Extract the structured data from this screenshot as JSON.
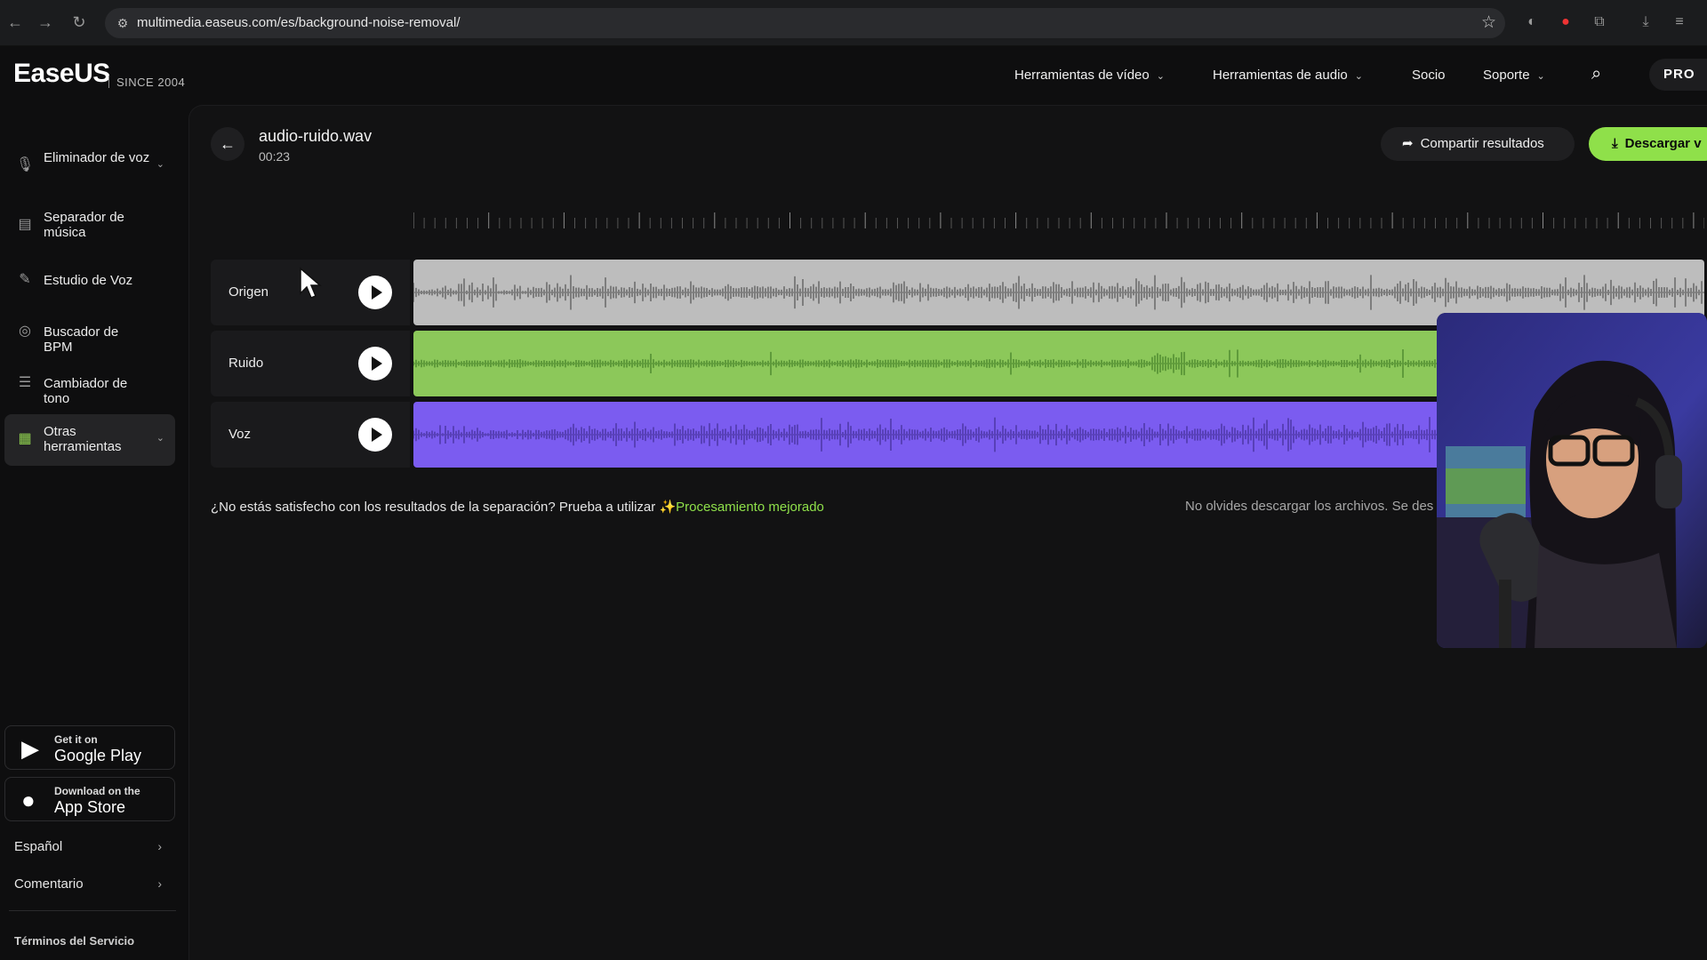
{
  "browser": {
    "url": "multimedia.easeus.com/es/background-noise-removal/"
  },
  "header": {
    "logo": "EaseUS",
    "since": "SINCE 2004",
    "menu": [
      {
        "label": "Herramientas de vídeo",
        "dropdown": true
      },
      {
        "label": "Herramientas de audio",
        "dropdown": true
      },
      {
        "label": "Socio",
        "dropdown": false
      },
      {
        "label": "Soporte",
        "dropdown": true
      }
    ],
    "pro_label": "PRO"
  },
  "sidebar": {
    "items": [
      {
        "label": "Eliminador de voz",
        "icon": "microphone-icon",
        "expandable": true
      },
      {
        "label": "Separador de música",
        "icon": "music-box-icon",
        "expandable": false
      },
      {
        "label": "Estudio de Voz",
        "icon": "magic-wand-icon",
        "expandable": false
      },
      {
        "label": "Buscador de BPM",
        "icon": "bpm-icon",
        "expandable": false
      },
      {
        "label": "Cambiador de tono",
        "icon": "sliders-icon",
        "expandable": false
      },
      {
        "label": "Otras herramientas",
        "icon": "grid-icon",
        "expandable": true,
        "active": true
      }
    ],
    "google_play": {
      "small": "Get it on",
      "big": "Google Play"
    },
    "app_store": {
      "small": "Download on the",
      "big": "App Store"
    },
    "language": "Español",
    "feedback": "Comentario",
    "terms": "Términos del Servicio"
  },
  "file": {
    "name": "audio-ruido.wav",
    "duration": "00:23",
    "back_icon": "arrow-left-icon"
  },
  "actions": {
    "share": "Compartir resultados",
    "download": "Descargar v"
  },
  "tracks": [
    {
      "name": "Origen",
      "color": "#bdbdbd",
      "wave_color": "#7d7d7d"
    },
    {
      "name": "Ruido",
      "color": "#8cc85a",
      "wave_color": "#5f9b3b"
    },
    {
      "name": "Voz",
      "color": "#7b5cf0",
      "wave_color": "#5840b8"
    }
  ],
  "hint": {
    "text": "¿No estás satisfecho con los resultados de la separación? Prueba a utilizar",
    "sparkle": "✨",
    "link": "Procesamiento mejorado",
    "note": "No olvides descargar los archivos. Se des"
  },
  "colors": {
    "accent": "#8fe04a",
    "background": "#0e0e0f"
  }
}
